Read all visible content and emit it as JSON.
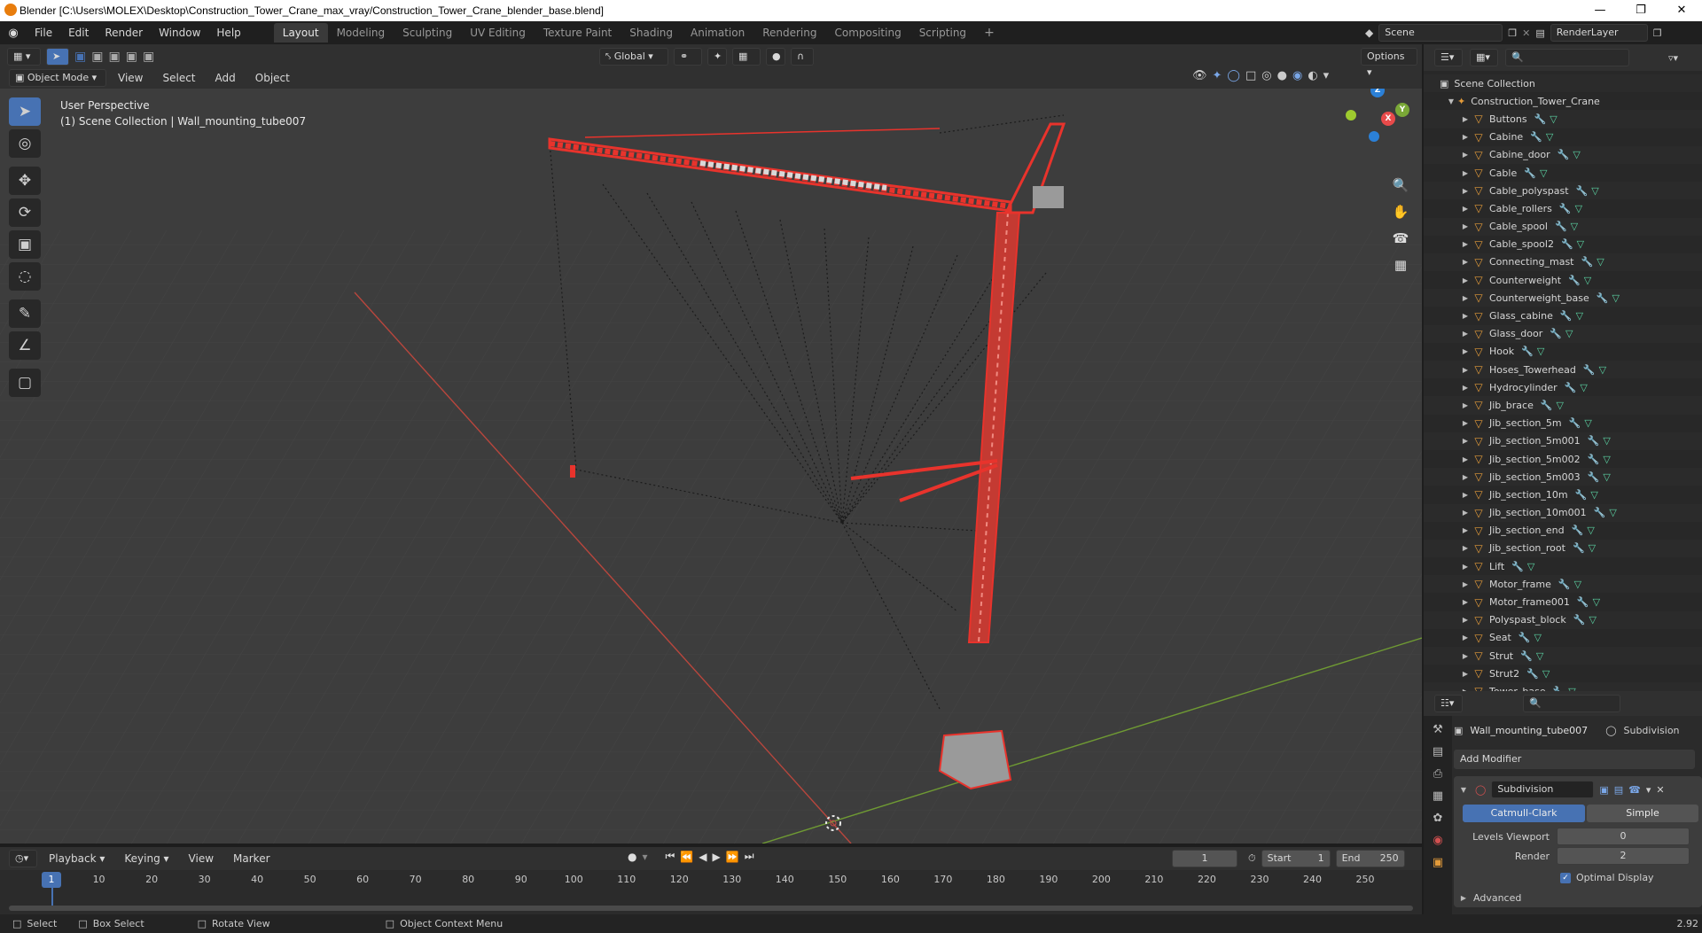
{
  "window": {
    "title": "Blender [C:\\Users\\MOLEX\\Desktop\\Construction_Tower_Crane_max_vray/Construction_Tower_Crane_blender_base.blend]"
  },
  "menu": [
    "File",
    "Edit",
    "Render",
    "Window",
    "Help"
  ],
  "workspaces": [
    {
      "label": "Layout",
      "active": true
    },
    {
      "label": "Modeling"
    },
    {
      "label": "Sculpting"
    },
    {
      "label": "UV Editing"
    },
    {
      "label": "Texture Paint"
    },
    {
      "label": "Shading"
    },
    {
      "label": "Animation"
    },
    {
      "label": "Rendering"
    },
    {
      "label": "Compositing"
    },
    {
      "label": "Scripting"
    }
  ],
  "scene": {
    "label": "Scene",
    "render_layer": "RenderLayer"
  },
  "viewport_header": {
    "mode": "Object Mode",
    "menus": [
      "View",
      "Select",
      "Add",
      "Object"
    ],
    "orientation": "Global",
    "options": "Options"
  },
  "viewport": {
    "perspective": "User Perspective",
    "context": "(1) Scene Collection | Wall_mounting_tube007",
    "axis_x": "X",
    "axis_y": "Y",
    "axis_z": "Z"
  },
  "outliner": {
    "root": "Scene Collection",
    "collection": "Construction_Tower_Crane",
    "objects": [
      "Buttons",
      "Cabine",
      "Cabine_door",
      "Cable",
      "Cable_polyspast",
      "Cable_rollers",
      "Cable_spool",
      "Cable_spool2",
      "Connecting_mast",
      "Counterweight",
      "Counterweight_base",
      "Glass_cabine",
      "Glass_door",
      "Hook",
      "Hoses_Towerhead",
      "Hydrocylinder",
      "Jib_brace",
      "Jib_section_5m",
      "Jib_section_5m001",
      "Jib_section_5m002",
      "Jib_section_5m003",
      "Jib_section_10m",
      "Jib_section_10m001",
      "Jib_section_end",
      "Jib_section_root",
      "Lift",
      "Motor_frame",
      "Motor_frame001",
      "Polyspast_block",
      "Seat",
      "Strut",
      "Strut2",
      "Tower_base"
    ]
  },
  "properties": {
    "object_name": "Wall_mounting_tube007",
    "modifier_tab": "Subdivision",
    "add_modifier": "Add Modifier",
    "modifier_name": "Subdivision",
    "type_catmull": "Catmull-Clark",
    "type_simple": "Simple",
    "levels_viewport_label": "Levels Viewport",
    "levels_viewport_value": "0",
    "render_label": "Render",
    "render_value": "2",
    "optimal_display": "Optimal Display",
    "advanced": "Advanced"
  },
  "timeline": {
    "menus": [
      "Playback",
      "Keying",
      "View",
      "Marker"
    ],
    "current_frame": "1",
    "start_label": "Start",
    "start_value": "1",
    "end_label": "End",
    "end_value": "250",
    "ticks": [
      "1",
      "10",
      "20",
      "30",
      "40",
      "50",
      "60",
      "70",
      "80",
      "90",
      "100",
      "110",
      "120",
      "130",
      "140",
      "150",
      "160",
      "170",
      "180",
      "190",
      "200",
      "210",
      "220",
      "230",
      "240",
      "250"
    ]
  },
  "statusbar": {
    "select": "Select",
    "box_select": "Box Select",
    "rotate_view": "Rotate View",
    "context_menu": "Object Context Menu",
    "version": "2.92"
  },
  "colors": {
    "accent": "#4772b3",
    "crane": "#e8332c",
    "x_axis": "#c8443a",
    "y_axis": "#7aa837"
  }
}
